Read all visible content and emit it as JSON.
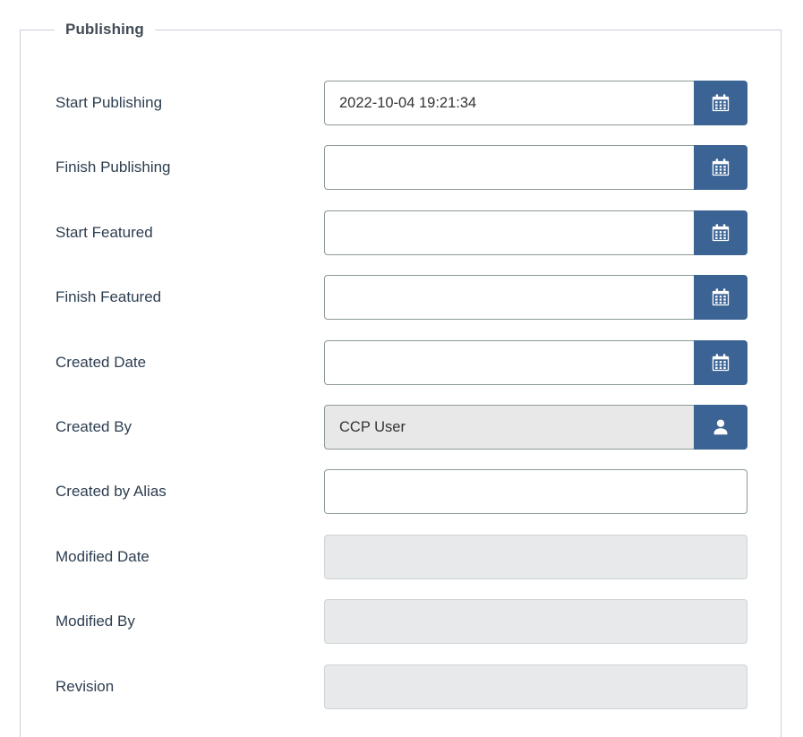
{
  "panel": {
    "legend": "Publishing",
    "accent_color": "#3b6394",
    "label_color": "#2d3e50",
    "field_border_color": "#8d9a94",
    "disabled_bg_color": "#e7e9eb",
    "readonly_bg_color": "#e8e8e8"
  },
  "fields": [
    {
      "label": "Start Publishing",
      "value": "2022-10-04 19:21:34",
      "placeholder": "",
      "state": "editable",
      "button": "calendar-icon",
      "button_title": "Calendar"
    },
    {
      "label": "Finish Publishing",
      "value": "",
      "placeholder": "",
      "state": "editable",
      "button": "calendar-icon",
      "button_title": "Calendar"
    },
    {
      "label": "Start Featured",
      "value": "",
      "placeholder": "",
      "state": "editable",
      "button": "calendar-icon",
      "button_title": "Calendar"
    },
    {
      "label": "Finish Featured",
      "value": "",
      "placeholder": "",
      "state": "editable",
      "button": "calendar-icon",
      "button_title": "Calendar"
    },
    {
      "label": "Created Date",
      "value": "",
      "placeholder": "",
      "state": "editable",
      "button": "calendar-icon",
      "button_title": "Calendar"
    },
    {
      "label": "Created By",
      "value": "CCP User",
      "placeholder": "",
      "state": "readonly",
      "button": "user-icon",
      "button_title": "Select User"
    },
    {
      "label": "Created by Alias",
      "value": "",
      "placeholder": "",
      "state": "editable",
      "button": "",
      "button_title": ""
    },
    {
      "label": "Modified Date",
      "value": "",
      "placeholder": "",
      "state": "disabled",
      "button": "",
      "button_title": ""
    },
    {
      "label": "Modified By",
      "value": "",
      "placeholder": "",
      "state": "disabled",
      "button": "",
      "button_title": ""
    },
    {
      "label": "Revision",
      "value": "",
      "placeholder": "",
      "state": "disabled",
      "button": "",
      "button_title": ""
    }
  ]
}
